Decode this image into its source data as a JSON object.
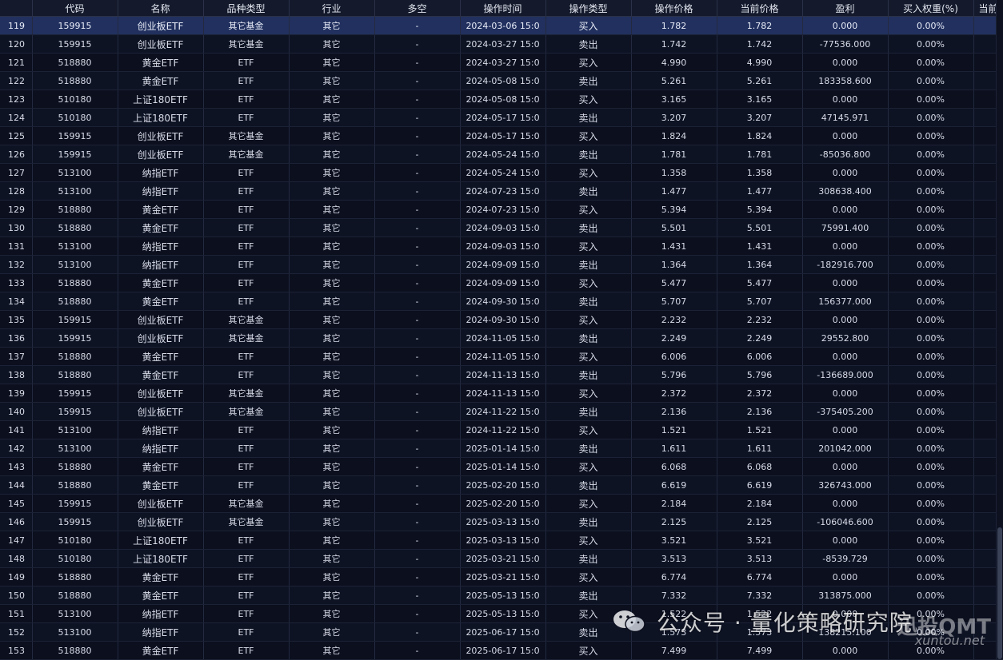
{
  "table": {
    "headers": [
      "",
      "代码",
      "名称",
      "品种类型",
      "行业",
      "多空",
      "操作时间",
      "操作类型",
      "操作价格",
      "当前价格",
      "盈利",
      "买入权重(%)",
      "当前"
    ],
    "rows": [
      [
        "119",
        "159915",
        "创业板ETF",
        "其它基金",
        "其它",
        "-",
        "2024-03-06 15:0",
        "买入",
        "1.782",
        "1.782",
        "0.000",
        "0.00%"
      ],
      [
        "120",
        "159915",
        "创业板ETF",
        "其它基金",
        "其它",
        "-",
        "2024-03-27 15:0",
        "卖出",
        "1.742",
        "1.742",
        "-77536.000",
        "0.00%"
      ],
      [
        "121",
        "518880",
        "黄金ETF",
        "ETF",
        "其它",
        "-",
        "2024-03-27 15:0",
        "买入",
        "4.990",
        "4.990",
        "0.000",
        "0.00%"
      ],
      [
        "122",
        "518880",
        "黄金ETF",
        "ETF",
        "其它",
        "-",
        "2024-05-08 15:0",
        "卖出",
        "5.261",
        "5.261",
        "183358.600",
        "0.00%"
      ],
      [
        "123",
        "510180",
        "上证180ETF",
        "ETF",
        "其它",
        "-",
        "2024-05-08 15:0",
        "买入",
        "3.165",
        "3.165",
        "0.000",
        "0.00%"
      ],
      [
        "124",
        "510180",
        "上证180ETF",
        "ETF",
        "其它",
        "-",
        "2024-05-17 15:0",
        "卖出",
        "3.207",
        "3.207",
        "47145.971",
        "0.00%"
      ],
      [
        "125",
        "159915",
        "创业板ETF",
        "其它基金",
        "其它",
        "-",
        "2024-05-17 15:0",
        "买入",
        "1.824",
        "1.824",
        "0.000",
        "0.00%"
      ],
      [
        "126",
        "159915",
        "创业板ETF",
        "其它基金",
        "其它",
        "-",
        "2024-05-24 15:0",
        "卖出",
        "1.781",
        "1.781",
        "-85036.800",
        "0.00%"
      ],
      [
        "127",
        "513100",
        "纳指ETF",
        "ETF",
        "其它",
        "-",
        "2024-05-24 15:0",
        "买入",
        "1.358",
        "1.358",
        "0.000",
        "0.00%"
      ],
      [
        "128",
        "513100",
        "纳指ETF",
        "ETF",
        "其它",
        "-",
        "2024-07-23 15:0",
        "卖出",
        "1.477",
        "1.477",
        "308638.400",
        "0.00%"
      ],
      [
        "129",
        "518880",
        "黄金ETF",
        "ETF",
        "其它",
        "-",
        "2024-07-23 15:0",
        "买入",
        "5.394",
        "5.394",
        "0.000",
        "0.00%"
      ],
      [
        "130",
        "518880",
        "黄金ETF",
        "ETF",
        "其它",
        "-",
        "2024-09-03 15:0",
        "卖出",
        "5.501",
        "5.501",
        "75991.400",
        "0.00%"
      ],
      [
        "131",
        "513100",
        "纳指ETF",
        "ETF",
        "其它",
        "-",
        "2024-09-03 15:0",
        "买入",
        "1.431",
        "1.431",
        "0.000",
        "0.00%"
      ],
      [
        "132",
        "513100",
        "纳指ETF",
        "ETF",
        "其它",
        "-",
        "2024-09-09 15:0",
        "卖出",
        "1.364",
        "1.364",
        "-182916.700",
        "0.00%"
      ],
      [
        "133",
        "518880",
        "黄金ETF",
        "ETF",
        "其它",
        "-",
        "2024-09-09 15:0",
        "买入",
        "5.477",
        "5.477",
        "0.000",
        "0.00%"
      ],
      [
        "134",
        "518880",
        "黄金ETF",
        "ETF",
        "其它",
        "-",
        "2024-09-30 15:0",
        "卖出",
        "5.707",
        "5.707",
        "156377.000",
        "0.00%"
      ],
      [
        "135",
        "159915",
        "创业板ETF",
        "其它基金",
        "其它",
        "-",
        "2024-09-30 15:0",
        "买入",
        "2.232",
        "2.232",
        "0.000",
        "0.00%"
      ],
      [
        "136",
        "159915",
        "创业板ETF",
        "其它基金",
        "其它",
        "-",
        "2024-11-05 15:0",
        "卖出",
        "2.249",
        "2.249",
        "29552.800",
        "0.00%"
      ],
      [
        "137",
        "518880",
        "黄金ETF",
        "ETF",
        "其它",
        "-",
        "2024-11-05 15:0",
        "买入",
        "6.006",
        "6.006",
        "0.000",
        "0.00%"
      ],
      [
        "138",
        "518880",
        "黄金ETF",
        "ETF",
        "其它",
        "-",
        "2024-11-13 15:0",
        "卖出",
        "5.796",
        "5.796",
        "-136689.000",
        "0.00%"
      ],
      [
        "139",
        "159915",
        "创业板ETF",
        "其它基金",
        "其它",
        "-",
        "2024-11-13 15:0",
        "买入",
        "2.372",
        "2.372",
        "0.000",
        "0.00%"
      ],
      [
        "140",
        "159915",
        "创业板ETF",
        "其它基金",
        "其它",
        "-",
        "2024-11-22 15:0",
        "卖出",
        "2.136",
        "2.136",
        "-375405.200",
        "0.00%"
      ],
      [
        "141",
        "513100",
        "纳指ETF",
        "ETF",
        "其它",
        "-",
        "2024-11-22 15:0",
        "买入",
        "1.521",
        "1.521",
        "0.000",
        "0.00%"
      ],
      [
        "142",
        "513100",
        "纳指ETF",
        "ETF",
        "其它",
        "-",
        "2025-01-14 15:0",
        "卖出",
        "1.611",
        "1.611",
        "201042.000",
        "0.00%"
      ],
      [
        "143",
        "518880",
        "黄金ETF",
        "ETF",
        "其它",
        "-",
        "2025-01-14 15:0",
        "买入",
        "6.068",
        "6.068",
        "0.000",
        "0.00%"
      ],
      [
        "144",
        "518880",
        "黄金ETF",
        "ETF",
        "其它",
        "-",
        "2025-02-20 15:0",
        "卖出",
        "6.619",
        "6.619",
        "326743.000",
        "0.00%"
      ],
      [
        "145",
        "159915",
        "创业板ETF",
        "其它基金",
        "其它",
        "-",
        "2025-02-20 15:0",
        "买入",
        "2.184",
        "2.184",
        "0.000",
        "0.00%"
      ],
      [
        "146",
        "159915",
        "创业板ETF",
        "其它基金",
        "其它",
        "-",
        "2025-03-13 15:0",
        "卖出",
        "2.125",
        "2.125",
        "-106046.600",
        "0.00%"
      ],
      [
        "147",
        "510180",
        "上证180ETF",
        "ETF",
        "其它",
        "-",
        "2025-03-13 15:0",
        "买入",
        "3.521",
        "3.521",
        "0.000",
        "0.00%"
      ],
      [
        "148",
        "510180",
        "上证180ETF",
        "ETF",
        "其它",
        "-",
        "2025-03-21 15:0",
        "卖出",
        "3.513",
        "3.513",
        "-8539.729",
        "0.00%"
      ],
      [
        "149",
        "518880",
        "黄金ETF",
        "ETF",
        "其它",
        "-",
        "2025-03-21 15:0",
        "买入",
        "6.774",
        "6.774",
        "0.000",
        "0.00%"
      ],
      [
        "150",
        "518880",
        "黄金ETF",
        "ETF",
        "其它",
        "-",
        "2025-05-13 15:0",
        "卖出",
        "7.332",
        "7.332",
        "313875.000",
        "0.00%"
      ],
      [
        "151",
        "513100",
        "纳指ETF",
        "ETF",
        "其它",
        "-",
        "2025-05-13 15:0",
        "买入",
        "1.522",
        "1.522",
        "0.000",
        "0.00%"
      ],
      [
        "152",
        "513100",
        "纳指ETF",
        "ETF",
        "其它",
        "-",
        "2025-06-17 15:0",
        "卖出",
        "1.573",
        "1.573",
        "138215.100",
        "0.00%"
      ],
      [
        "153",
        "518880",
        "黄金ETF",
        "ETF",
        "其它",
        "-",
        "2025-06-17 15:0",
        "买入",
        "7.499",
        "7.499",
        "0.000",
        "0.00%"
      ]
    ],
    "selected_row": 0
  },
  "watermark": {
    "text": "公众号 · 量化策略研究院",
    "brand": "迅投QMT",
    "url": "xuntou.net"
  },
  "colors": {
    "background": "#0b0f1e",
    "selected_row": "#21305e",
    "header": "#141a2c"
  }
}
